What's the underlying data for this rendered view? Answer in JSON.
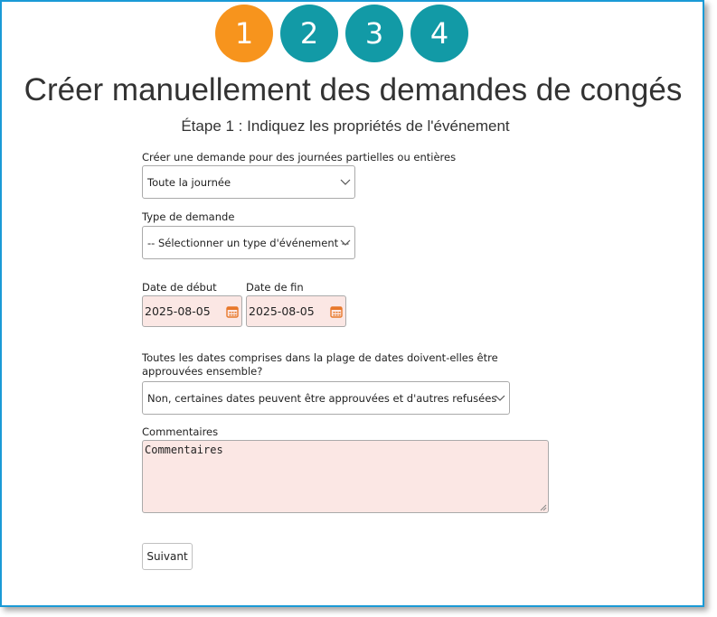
{
  "stepper": {
    "steps": [
      "1",
      "2",
      "3",
      "4"
    ],
    "active_step": 1
  },
  "page": {
    "title": "Créer manuellement des demandes de congés",
    "subtitle": "Étape 1 : Indiquez les propriétés de l'événement"
  },
  "form": {
    "duration": {
      "label": "Créer une demande pour des journées partielles ou entières",
      "value": "Toute la journée"
    },
    "request_type": {
      "label": "Type de demande",
      "value": "-- Sélectionner un type d'événement --"
    },
    "start_date": {
      "label": "Date de début",
      "value": "2025-08-05"
    },
    "end_date": {
      "label": "Date de fin",
      "value": "2025-08-05"
    },
    "approval": {
      "label": "Toutes les dates comprises dans la plage de dates doivent-elles être approuvées ensemble?",
      "value": "Non, certaines dates peuvent être approuvées et d'autres refusées"
    },
    "comments": {
      "label": "Commentaires",
      "value": "Commentaires"
    },
    "next_button": "Suivant"
  },
  "colors": {
    "active_step": "#f7941d",
    "inactive_step": "#129aa6",
    "frame_border": "#1a9ad6",
    "required_field_bg": "#fbe7e4",
    "calendar_icon": "#e8782a"
  },
  "icons": {
    "dropdown": "chevron-down-icon",
    "date_picker": "calendar-icon"
  }
}
